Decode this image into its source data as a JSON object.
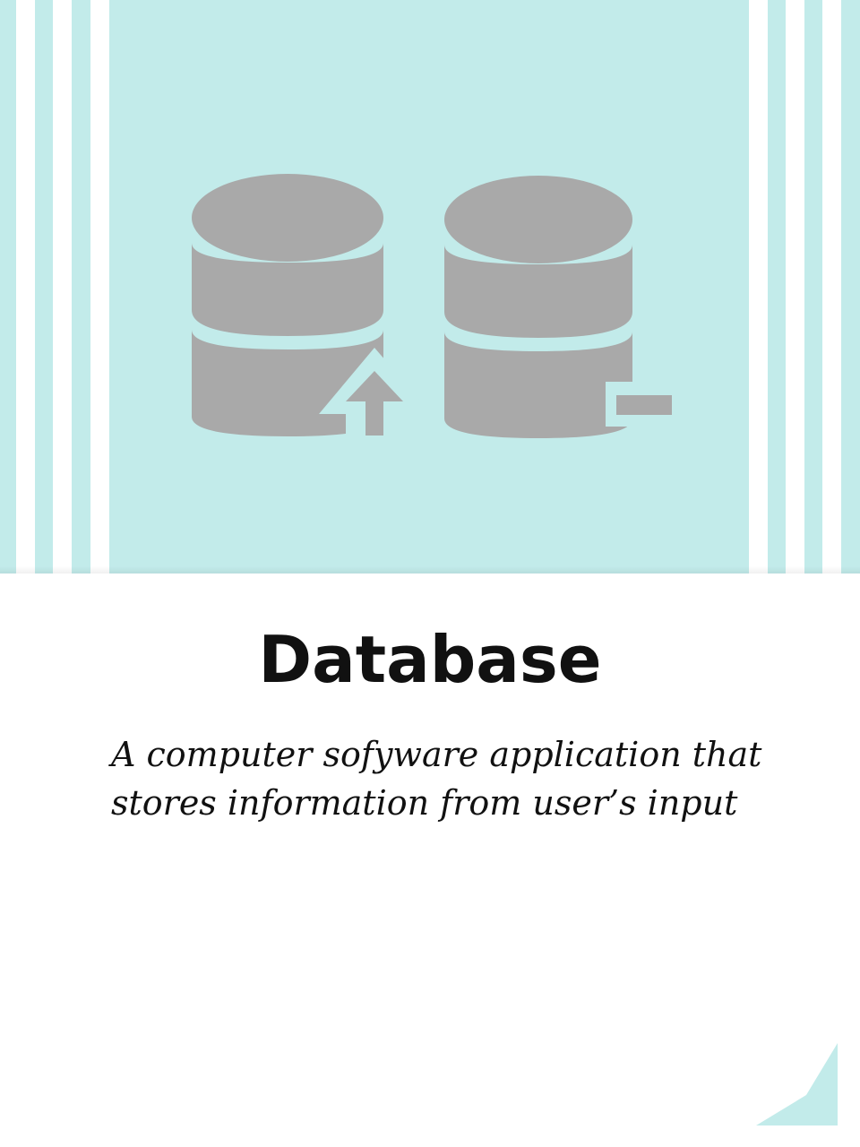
{
  "hero": {
    "background_color": "#c2ebea",
    "stripe_color": "#ffffff",
    "icons": [
      {
        "name": "database-upload-icon",
        "color": "#a9a9a9"
      },
      {
        "name": "database-minus-icon",
        "color": "#a9a9a9"
      }
    ]
  },
  "card": {
    "title": "Database",
    "description": "A computer sofyware application that stores information from user’s input"
  },
  "decoration": {
    "corner_fold_color": "#c2ebea"
  }
}
